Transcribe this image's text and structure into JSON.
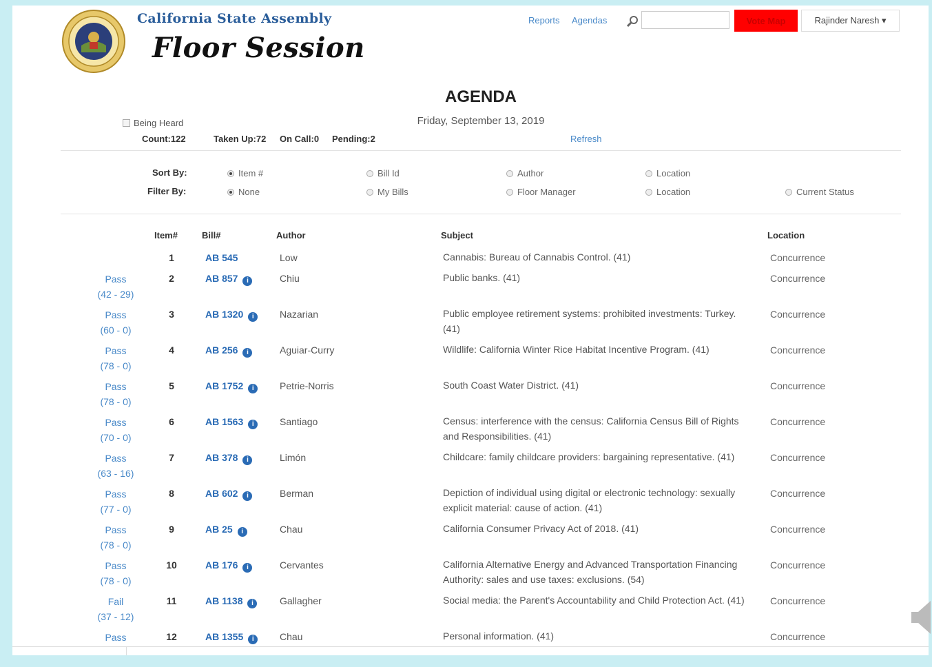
{
  "header": {
    "org": "California State Assembly",
    "title": "Floor Session",
    "links": [
      "Reports",
      "Agendas"
    ],
    "vote_button": "Vote Map",
    "user": "Rajinder Naresh"
  },
  "agenda": {
    "title": "AGENDA",
    "date": "Friday, September 13, 2019",
    "refresh": "Refresh",
    "being_heard": "Being Heard",
    "count": "Count:122",
    "taken_up": "Taken Up:72",
    "on_call": "On Call:0",
    "pending": "Pending:2"
  },
  "sort": {
    "label": "Sort By:",
    "options": [
      "Item #",
      "Bill Id",
      "Author",
      "Location"
    ]
  },
  "filter": {
    "label": "Filter By:",
    "options": [
      "None",
      "My Bills",
      "Floor Manager",
      "Location",
      "Current Status"
    ]
  },
  "columns": {
    "item": "Item#",
    "bill": "Bill#",
    "author": "Author",
    "subject": "Subject",
    "location": "Location"
  },
  "rows": [
    {
      "result": "",
      "tally": "",
      "item": "1",
      "bill": "AB 545",
      "info": false,
      "author": "Low",
      "subject": "Cannabis: Bureau of Cannabis Control. (41)",
      "location": "Concurrence"
    },
    {
      "result": "Pass",
      "tally": "(42 - 29)",
      "item": "2",
      "bill": "AB 857",
      "info": true,
      "author": "Chiu",
      "subject": "Public banks. (41)",
      "location": "Concurrence"
    },
    {
      "result": "Pass",
      "tally": "(60 - 0)",
      "item": "3",
      "bill": "AB 1320",
      "info": true,
      "author": "Nazarian",
      "subject": "Public employee retirement systems: prohibited investments: Turkey. (41)",
      "location": "Concurrence"
    },
    {
      "result": "Pass",
      "tally": "(78 - 0)",
      "item": "4",
      "bill": "AB 256",
      "info": true,
      "author": "Aguiar-Curry",
      "subject": "Wildlife: California Winter Rice Habitat Incentive Program. (41)",
      "location": "Concurrence"
    },
    {
      "result": "Pass",
      "tally": "(78 - 0)",
      "item": "5",
      "bill": "AB 1752",
      "info": true,
      "author": "Petrie-Norris",
      "subject": "South Coast Water District. (41)",
      "location": "Concurrence"
    },
    {
      "result": "Pass",
      "tally": "(70 - 0)",
      "item": "6",
      "bill": "AB 1563",
      "info": true,
      "author": "Santiago",
      "subject": "Census: interference with the census: California Census Bill of Rights and Responsibilities. (41)",
      "location": "Concurrence"
    },
    {
      "result": "Pass",
      "tally": "(63 - 16)",
      "item": "7",
      "bill": "AB 378",
      "info": true,
      "author": "Limón",
      "subject": "Childcare: family childcare providers: bargaining representative. (41)",
      "location": "Concurrence"
    },
    {
      "result": "Pass",
      "tally": "(77 - 0)",
      "item": "8",
      "bill": "AB 602",
      "info": true,
      "author": "Berman",
      "subject": "Depiction of individual using digital or electronic technology: sexually explicit material: cause of action. (41)",
      "location": "Concurrence"
    },
    {
      "result": "Pass",
      "tally": "(78 - 0)",
      "item": "9",
      "bill": "AB 25",
      "info": true,
      "author": "Chau",
      "subject": "California Consumer Privacy Act of 2018. (41)",
      "location": "Concurrence"
    },
    {
      "result": "Pass",
      "tally": "(78 - 0)",
      "item": "10",
      "bill": "AB 176",
      "info": true,
      "author": "Cervantes",
      "subject": "California Alternative Energy and Advanced Transportation Financing Authority: sales and use taxes: exclusions. (54)",
      "location": "Concurrence"
    },
    {
      "result": "Fail",
      "tally": "(37 - 12)",
      "item": "11",
      "bill": "AB 1138",
      "info": true,
      "author": "Gallagher",
      "subject": "Social media: the Parent's Accountability and Child Protection Act. (41)",
      "location": "Concurrence"
    },
    {
      "result": "Pass",
      "tally": "",
      "item": "12",
      "bill": "AB 1355",
      "info": true,
      "author": "Chau",
      "subject": "Personal information. (41)",
      "location": "Concurrence"
    }
  ],
  "colors": {
    "accent": "#2a6bb5",
    "link": "#4a8ac9",
    "vote_button": "#ff0000",
    "background": "#c9eef3"
  }
}
